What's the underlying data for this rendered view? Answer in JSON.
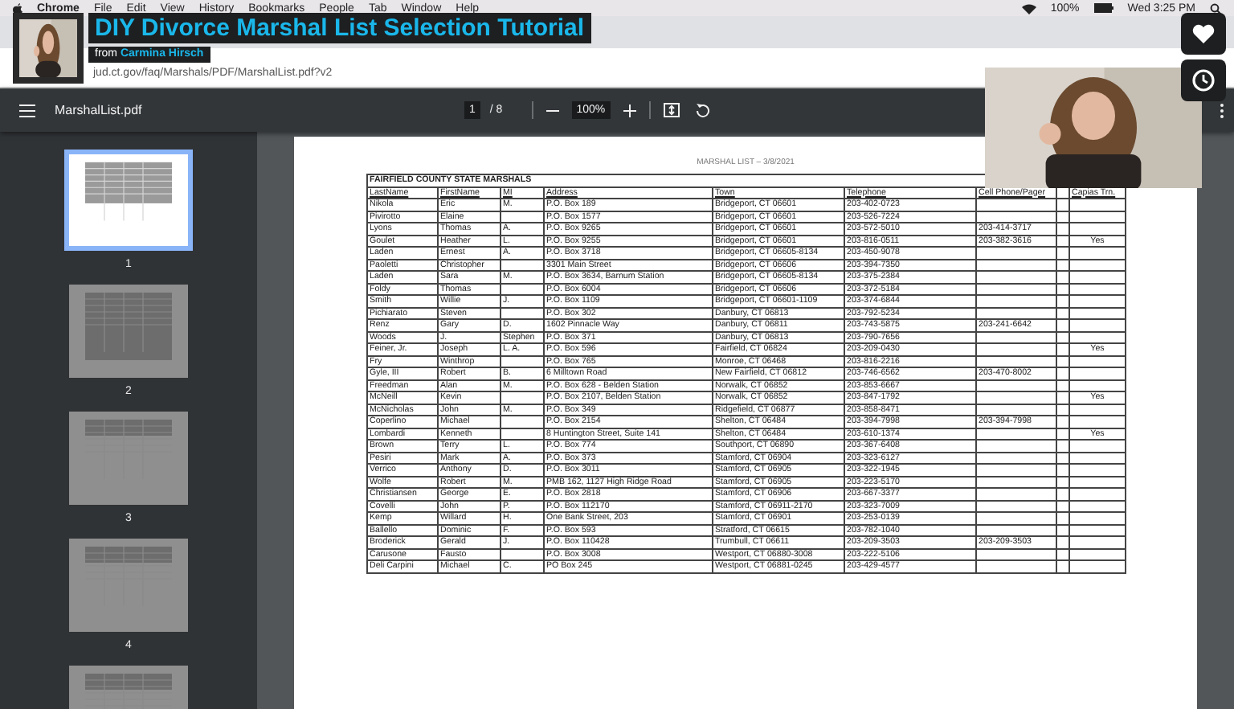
{
  "menu_bar": {
    "app": "Chrome",
    "items": [
      "File",
      "Edit",
      "View",
      "History",
      "Bookmarks",
      "People",
      "Tab",
      "Window",
      "Help"
    ],
    "battery": "100%",
    "clock": "Wed 3:25 PM"
  },
  "video_overlay": {
    "title": "DIY Divorce Marshal List Selection Tutorial",
    "byline_prefix": "from",
    "author": "Carmina Hirsch"
  },
  "browser": {
    "url": "jud.ct.gov/faq/Marshals/PDF/MarshalList.pdf?v2"
  },
  "pdf_toolbar": {
    "file_name": "MarshalList.pdf",
    "page": "1",
    "page_count": "/ 8",
    "zoom": "100%"
  },
  "thumbnails": [
    {
      "label": "1",
      "selected": true
    },
    {
      "label": "2",
      "selected": false
    },
    {
      "label": "3",
      "selected": false
    },
    {
      "label": "4",
      "selected": false
    },
    {
      "selected": false
    }
  ],
  "document": {
    "heading": "MARSHAL LIST – 3/8/2021",
    "table": {
      "title": "FAIRFIELD COUNTY STATE MARSHALS",
      "columns": [
        "LastName",
        "FirstName",
        "MI",
        "Address",
        "Town",
        "Telephone",
        "Cell Phone/Pager",
        null,
        "Capias Trn."
      ],
      "rows": [
        [
          "Nikola",
          "Eric",
          "M.",
          "P.O. Box 189",
          "Bridgeport, CT 06601",
          "203-402-0723",
          null,
          null,
          null
        ],
        [
          "Pivirotto",
          "Elaine",
          null,
          "P.O. Box 1577",
          "Bridgeport, CT 06601",
          "203-526-7224",
          null,
          null,
          null
        ],
        [
          "Lyons",
          "Thomas",
          "A.",
          "P.O. Box 9265",
          "Bridgeport, CT 06601",
          "203-572-5010",
          "203-414-3717",
          null,
          null
        ],
        [
          "Goulet",
          "Heather",
          "L.",
          "P.O. Box 9255",
          "Bridgeport, CT 06601",
          "203-816-0511",
          "203-382-3616",
          null,
          "Yes"
        ],
        [
          "Laden",
          "Ernest",
          "A.",
          "P.O. Box 3718",
          "Bridgeport, CT 06605-8134",
          "203-450-9078",
          null,
          null,
          null
        ],
        [
          "Paoletti",
          "Christopher",
          null,
          "3301 Main Street",
          "Bridgeport, CT 06606",
          "203-394-7350",
          null,
          null,
          null
        ],
        [
          "Laden",
          "Sara",
          "M.",
          "P.O. Box 3634, Barnum Station",
          "Bridgeport, CT 06605-8134",
          "203-375-2384",
          null,
          null,
          null
        ],
        [
          "Foldy",
          "Thomas",
          null,
          "P.O. Box 6004",
          "Bridgeport, CT 06606",
          "203-372-5184",
          null,
          null,
          null
        ],
        [
          "Smith",
          "Willie",
          "J.",
          "P.O. Box 1109",
          "Bridgeport, CT 06601-1109",
          "203-374-6844",
          null,
          null,
          null
        ],
        [
          "Pichiarato",
          "Steven",
          null,
          "P.O. Box 302",
          "Danbury, CT 06813",
          "203-792-5234",
          null,
          null,
          null
        ],
        [
          "Renz",
          "Gary",
          "D.",
          "1602 Pinnacle Way",
          "Danbury, CT 06811",
          "203-743-5875",
          "203-241-6642",
          null,
          null
        ],
        [
          "Woods",
          "J.",
          "Stephen",
          "P.O. Box 371",
          "Danbury, CT 06813",
          "203-790-7656",
          null,
          null,
          null
        ],
        [
          "Feiner, Jr.",
          "Joseph",
          "L. A.",
          "P.O. Box 596",
          "Fairfield, CT 06824",
          "203-209-0430",
          null,
          null,
          "Yes"
        ],
        [
          "Fry",
          "Winthrop",
          null,
          "P.O. Box 765",
          "Monroe, CT 06468",
          "203-816-2216",
          null,
          null,
          null
        ],
        [
          "Gyle, III",
          "Robert",
          "B.",
          "6 Milltown Road",
          "New Fairfield, CT 06812",
          "203-746-6562",
          "203-470-8002",
          null,
          null
        ],
        [
          "Freedman",
          "Alan",
          "M.",
          "P.O. Box 628 - Belden Station",
          "Norwalk, CT 06852",
          "203-853-6667",
          null,
          null,
          null
        ],
        [
          "McNeill",
          "Kevin",
          null,
          "P.O. Box 2107, Belden Station",
          "Norwalk, CT 06852",
          "203-847-1792",
          null,
          null,
          "Yes"
        ],
        [
          "McNicholas",
          "John",
          "M.",
          "P.O. Box 349",
          "Ridgefield, CT 06877",
          "203-858-8471",
          null,
          null,
          null
        ],
        [
          "Coperlino",
          "Michael",
          null,
          "P.O. Box 2154",
          "Shelton, CT 06484",
          "203-394-7998",
          "203-394-7998",
          null,
          null
        ],
        [
          "Lombardi",
          "Kenneth",
          null,
          "8 Huntington Street, Suite 141",
          "Shelton, CT 06484",
          "203-610-1374",
          null,
          null,
          "Yes"
        ],
        [
          "Brown",
          "Terry",
          "L.",
          "P.O. Box 774",
          "Southport, CT 06890",
          "203-367-6408",
          null,
          null,
          null
        ],
        [
          "Pesiri",
          "Mark",
          "A.",
          "P.O. Box 373",
          "Stamford, CT 06904",
          "203-323-6127",
          null,
          null,
          null
        ],
        [
          "Verrico",
          "Anthony",
          "D.",
          "P.O. Box 3011",
          "Stamford, CT 06905",
          "203-322-1945",
          null,
          null,
          null
        ],
        [
          "Wolfe",
          "Robert",
          "M.",
          "PMB 162, 1127 High Ridge Road",
          "Stamford, CT 06905",
          "203-223-5170",
          null,
          null,
          null
        ],
        [
          "Christiansen",
          "George",
          "E.",
          "P.O. Box 2818",
          "Stamford, CT 06906",
          "203-667-3377",
          null,
          null,
          null
        ],
        [
          "Covelli",
          "John",
          "P.",
          "P.O. Box 112170",
          "Stamford, CT 06911-2170",
          "203-323-7009",
          null,
          null,
          null
        ],
        [
          "Kemp",
          "Willard",
          "H.",
          "One Bank Street, 203",
          "Stamford, CT 06901",
          "203-253-0139",
          null,
          null,
          null
        ],
        [
          "Ballello",
          "Dominic",
          "F.",
          "P.O. Box 593",
          "Stratford, CT 06615",
          "203-782-1040",
          null,
          null,
          null
        ],
        [
          "Broderick",
          "Gerald",
          "J.",
          "P.O. Box 110428",
          "Trumbull, CT 06611",
          "203-209-3503",
          "203-209-3503",
          null,
          null
        ],
        [
          "Carusone",
          "Fausto",
          null,
          "P.O. Box 3008",
          "Westport, CT 06880-3008",
          "203-222-5106",
          null,
          null,
          null
        ],
        [
          "Deli Carpini",
          "Michael",
          "C.",
          "PO Box 245",
          "Westport, CT 06881-0245",
          "203-429-4577",
          null,
          null,
          null
        ]
      ]
    }
  }
}
